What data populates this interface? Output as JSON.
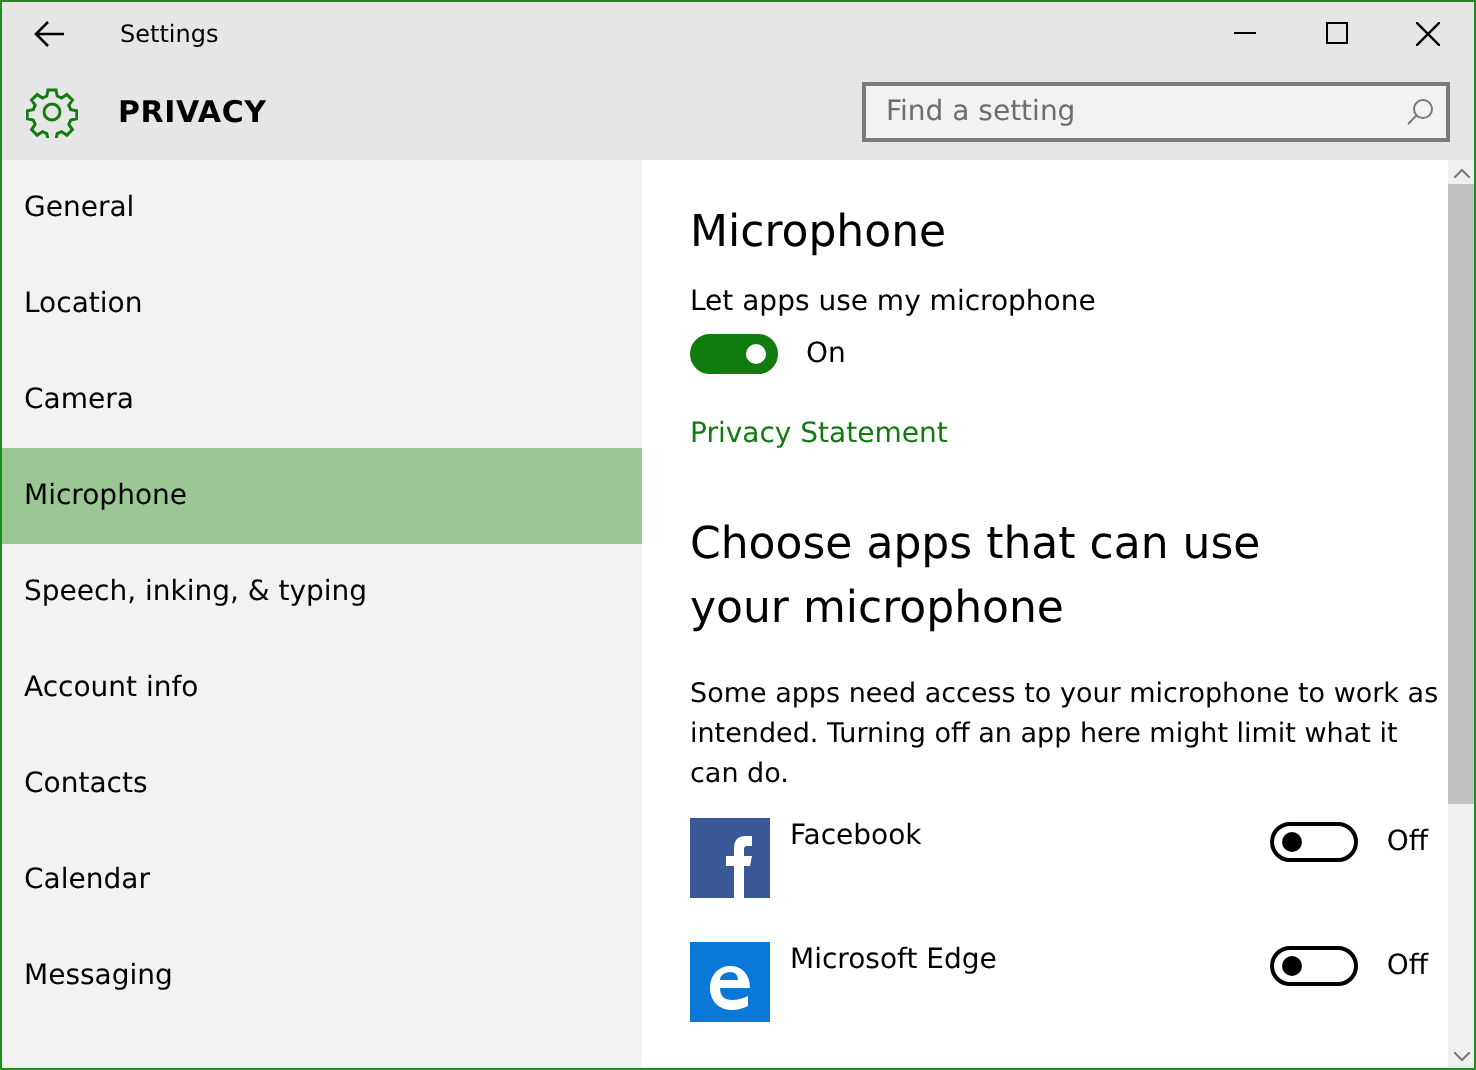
{
  "window": {
    "title": "Settings"
  },
  "header": {
    "title": "PRIVACY",
    "search": {
      "placeholder": "Find a setting"
    }
  },
  "sidebar": {
    "items": [
      {
        "label": "General",
        "selected": false
      },
      {
        "label": "Location",
        "selected": false
      },
      {
        "label": "Camera",
        "selected": false
      },
      {
        "label": "Microphone",
        "selected": true
      },
      {
        "label": "Speech, inking, & typing",
        "selected": false
      },
      {
        "label": "Account info",
        "selected": false
      },
      {
        "label": "Contacts",
        "selected": false
      },
      {
        "label": "Calendar",
        "selected": false
      },
      {
        "label": "Messaging",
        "selected": false
      }
    ]
  },
  "content": {
    "title": "Microphone",
    "toggle": {
      "label": "Let apps use my microphone",
      "on": true,
      "state_text": "On"
    },
    "link": "Privacy Statement",
    "section_title": "Choose apps that can use your microphone",
    "description": "Some apps need access to your microphone to work as intended. Turning off an app here might limit what it can do.",
    "apps": [
      {
        "kind": "facebook",
        "name": "Facebook",
        "on": false,
        "state_text": "Off"
      },
      {
        "kind": "edge",
        "name": "Microsoft Edge",
        "on": false,
        "state_text": "Off"
      }
    ]
  }
}
